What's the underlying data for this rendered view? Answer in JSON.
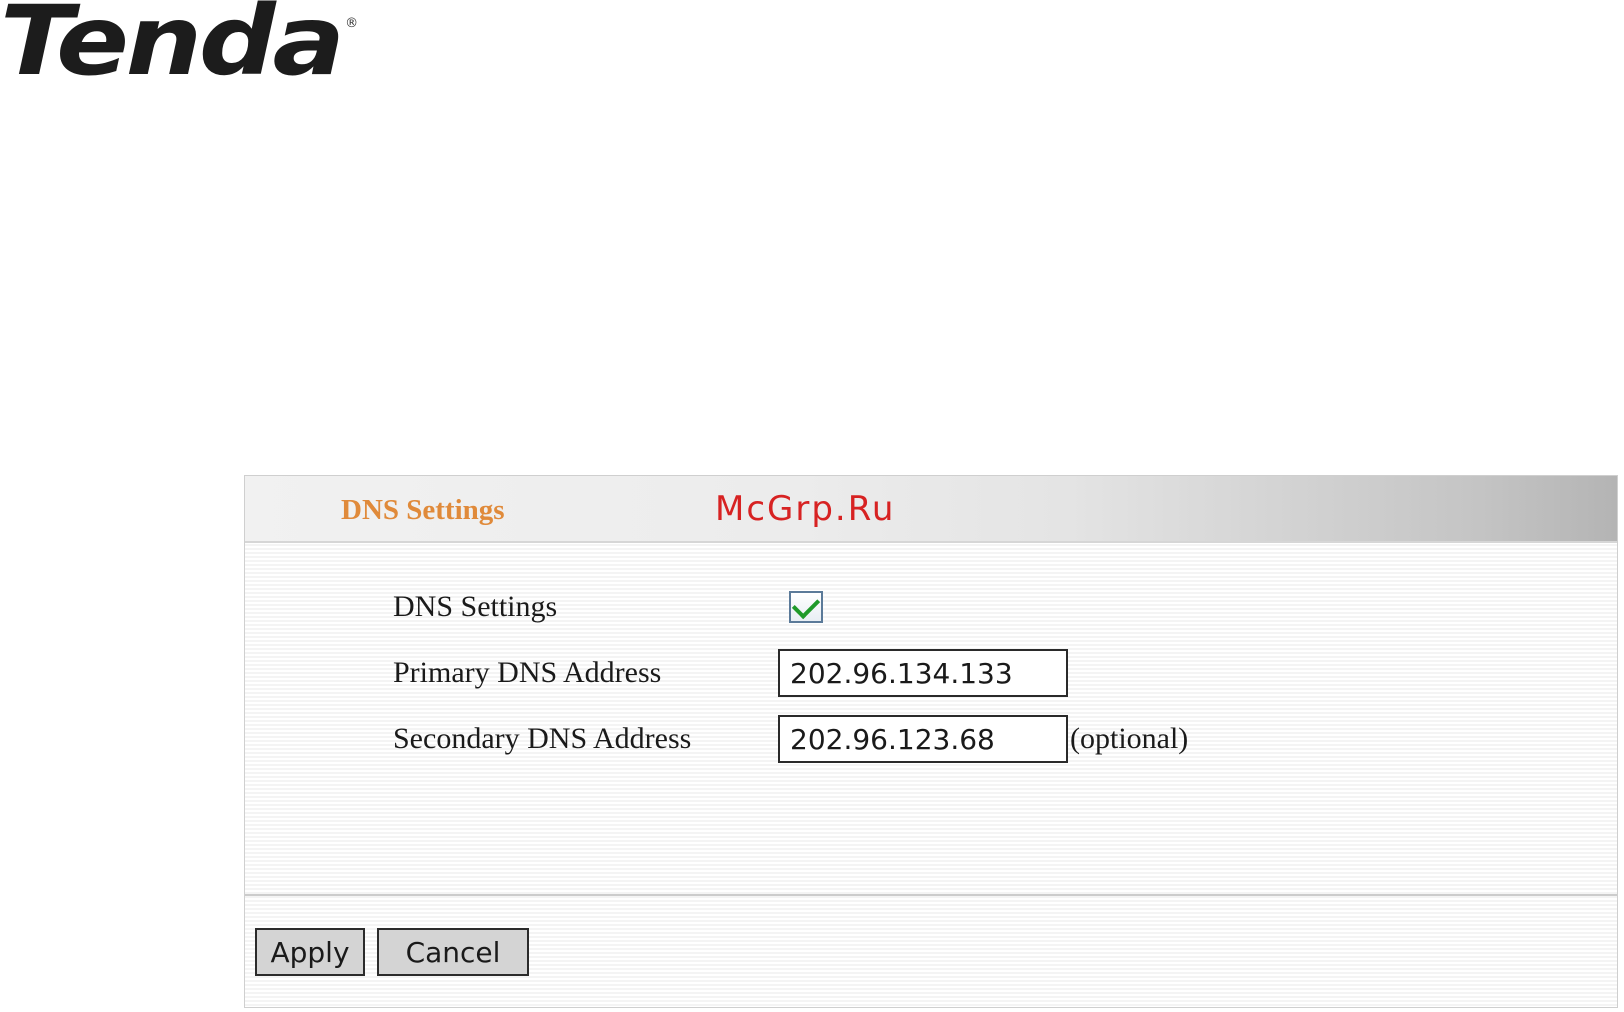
{
  "brand": {
    "name": "Tenda",
    "registered": "®"
  },
  "watermark": "McGrp.Ru",
  "panel": {
    "title": "DNS Settings"
  },
  "form": {
    "dns_settings": {
      "label": "DNS Settings",
      "checked": true
    },
    "primary_dns": {
      "label": "Primary DNS Address",
      "value": "202.96.134.133"
    },
    "secondary_dns": {
      "label": "Secondary DNS Address",
      "value": "202.96.123.68",
      "note": "(optional)"
    }
  },
  "buttons": {
    "apply": "Apply",
    "cancel": "Cancel"
  },
  "colors": {
    "title": "#e08a3a",
    "watermark": "#d72222",
    "check": "#1f9a2a"
  },
  "icons": {
    "check": "check-icon"
  }
}
